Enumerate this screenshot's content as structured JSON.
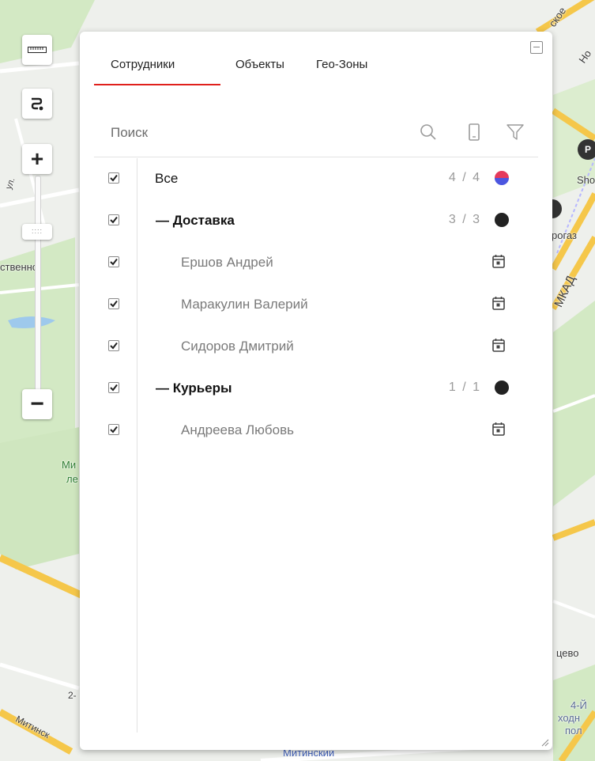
{
  "map": {
    "labels": {
      "top_right_road": "ское",
      "top_right_corner": "Но",
      "poi_shop": "Sho",
      "metro_station": "рогаз",
      "district_left": "ственно",
      "mkad": "МКАД",
      "ul": "ул.",
      "green_area_1": "Ми",
      "green_area_2": "ле",
      "bottom_right_1": "цево",
      "bottom_right_2": "4-Й",
      "bottom_right_3": "ходн",
      "bottom_right_4": "пол",
      "bottom_left_street": "Митинск",
      "bottom_left_num": "2-",
      "bottom_center": "Митинский"
    },
    "colors": {
      "road_major": "#f5c74a",
      "road_minor": "#ffffff",
      "park": "#d3e9c4",
      "water": "#9ec9ec",
      "ground": "#eef0ec"
    }
  },
  "controls": {
    "ruler": "ruler-icon",
    "route": "route-icon",
    "zoom_in": "+",
    "zoom_out": "−",
    "zoom_handle": "::::",
    "zoom_level": 0.25
  },
  "panel": {
    "tabs": [
      {
        "label": "Сотрудники",
        "active": true
      },
      {
        "label": "Объекты",
        "active": false
      },
      {
        "label": "Гео-Зоны",
        "active": false
      }
    ],
    "accent_color": "#e0201c",
    "search": {
      "placeholder": "Поиск",
      "value": ""
    },
    "toolbar_icons": [
      "search-icon",
      "phone-icon",
      "filter-icon"
    ],
    "tree": [
      {
        "type": "all",
        "label": "Все",
        "count": "4 / 4",
        "checked": true,
        "marker": "multicolor-dot"
      },
      {
        "type": "group",
        "label": "— Доставка",
        "count": "3 / 3",
        "checked": true,
        "marker": "black-dot"
      },
      {
        "type": "person",
        "label": "Ершов Андрей",
        "checked": true,
        "marker": "calendar-icon"
      },
      {
        "type": "person",
        "label": "Маракулин Валерий",
        "checked": true,
        "marker": "calendar-icon"
      },
      {
        "type": "person",
        "label": "Сидоров Дмитрий",
        "checked": true,
        "marker": "calendar-icon"
      },
      {
        "type": "group",
        "label": "— Курьеры",
        "count": "1 / 1",
        "checked": true,
        "marker": "black-dot"
      },
      {
        "type": "person",
        "label": "Андреева Любовь",
        "checked": true,
        "marker": "calendar-icon"
      }
    ]
  }
}
